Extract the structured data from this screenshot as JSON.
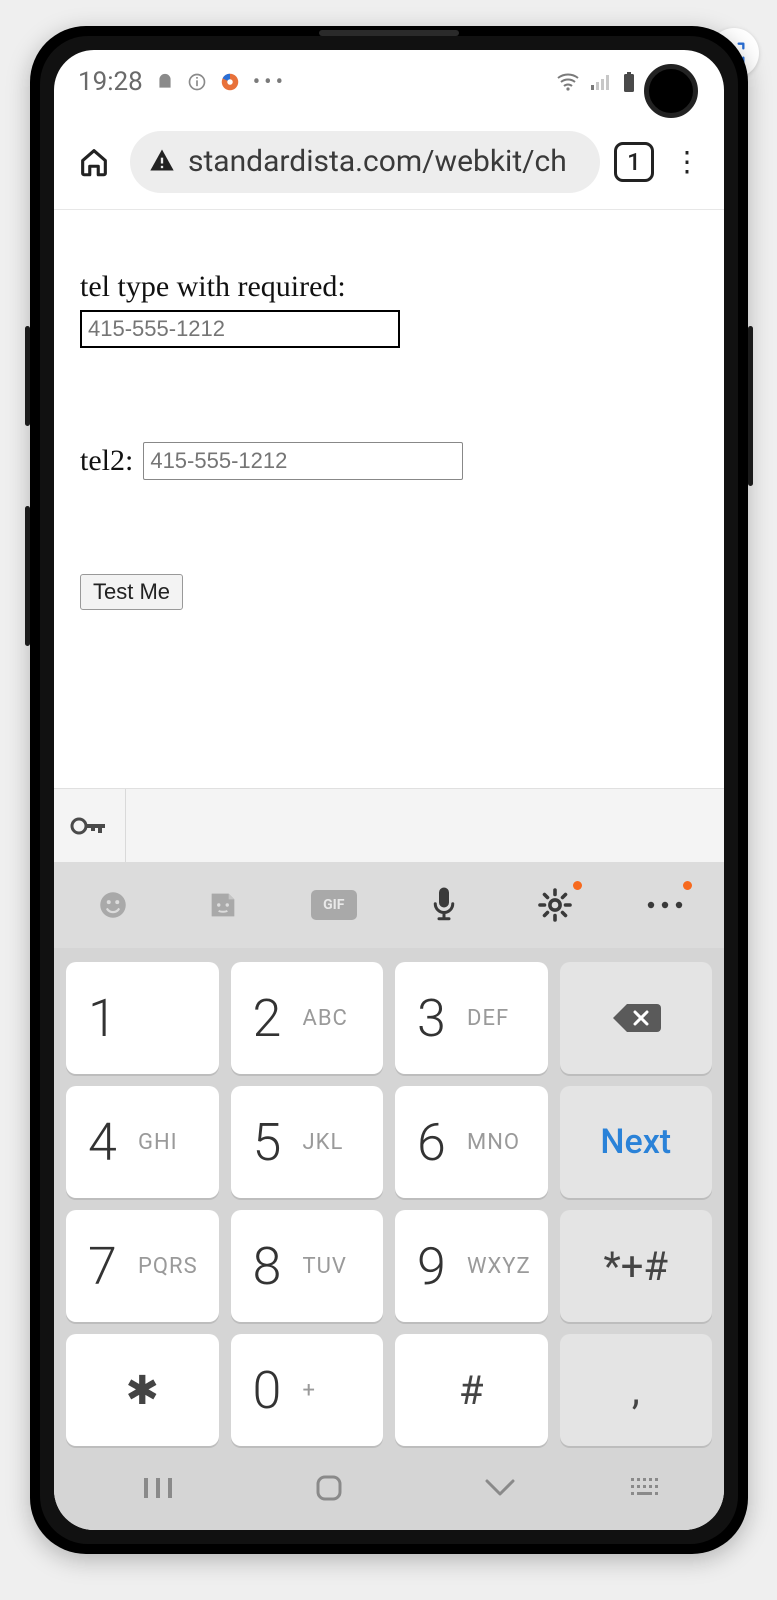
{
  "status": {
    "time": "19:28",
    "icons": {
      "android": "android-icon",
      "info": "info-icon",
      "browser": "browser-swirl-icon",
      "more": "•••"
    },
    "right": {
      "wifi": "wifi-icon",
      "signal": "signal-icon",
      "battery": "battery-icon"
    }
  },
  "chrome": {
    "url": "standardista.com/webkit/ch",
    "tab_count": "1"
  },
  "page": {
    "tel1_label": "tel type with required:",
    "tel1_placeholder": "415-555-1212",
    "tel2_label": "tel2:",
    "tel2_placeholder": "415-555-1212",
    "button": "Test Me"
  },
  "keyboard": {
    "toolbar": {
      "gif": "GIF"
    },
    "next": "Next",
    "keys": [
      {
        "num": "1",
        "letters": ""
      },
      {
        "num": "2",
        "letters": "ABC"
      },
      {
        "num": "3",
        "letters": "DEF"
      },
      {
        "num": "4",
        "letters": "GHI"
      },
      {
        "num": "5",
        "letters": "JKL"
      },
      {
        "num": "6",
        "letters": "MNO"
      },
      {
        "num": "7",
        "letters": "PQRS"
      },
      {
        "num": "8",
        "letters": "TUV"
      },
      {
        "num": "9",
        "letters": "WXYZ"
      },
      {
        "sym": "✱"
      },
      {
        "num": "0",
        "letters": "+"
      },
      {
        "sym": "#"
      }
    ],
    "sym_key": "*+#",
    "comma": ","
  }
}
